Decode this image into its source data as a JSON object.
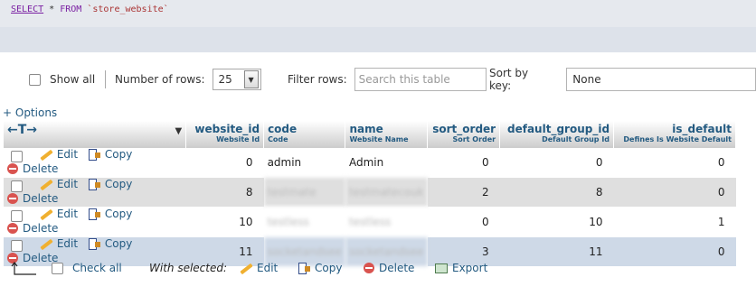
{
  "sql": {
    "select": "SELECT",
    "star": "*",
    "from": "FROM",
    "table": "`store_website`"
  },
  "controls": {
    "show_all_label": "Show all",
    "rows_label": "Number of rows:",
    "rows_value": "25",
    "filter_label": "Filter rows:",
    "filter_placeholder": "Search this table",
    "sort_label": "Sort by key:",
    "sort_value": "None"
  },
  "options_link": "+ Options",
  "table": {
    "nav_arrows": "←T→",
    "columns": [
      {
        "name": "website_id",
        "comment": "Website Id",
        "align": "num"
      },
      {
        "name": "code",
        "comment": "Code",
        "align": "txt"
      },
      {
        "name": "name",
        "comment": "Website Name",
        "align": "txt"
      },
      {
        "name": "sort_order",
        "comment": "Sort Order",
        "align": "num"
      },
      {
        "name": "default_group_id",
        "comment": "Default Group Id",
        "align": "num"
      },
      {
        "name": "is_default",
        "comment": "Defines Is Website Default",
        "align": "num"
      }
    ],
    "action_labels": {
      "edit": "Edit",
      "copy": "Copy",
      "delete": "Delete"
    },
    "rows": [
      {
        "website_id": "0",
        "code": "admin",
        "name": "Admin",
        "sort_order": "0",
        "default_group_id": "0",
        "is_default": "0",
        "style": "odd"
      },
      {
        "website_id": "8",
        "code": "testmate",
        "name": "testmatecouk",
        "sort_order": "2",
        "default_group_id": "8",
        "is_default": "0",
        "style": "even",
        "redacted": true
      },
      {
        "website_id": "10",
        "code": "testless",
        "name": "testless",
        "sort_order": "0",
        "default_group_id": "10",
        "is_default": "1",
        "style": "odd",
        "redacted": true
      },
      {
        "website_id": "11",
        "code": "socketandsee",
        "name": "socketandsee",
        "sort_order": "3",
        "default_group_id": "11",
        "is_default": "0",
        "style": "marked",
        "redacted": true
      }
    ]
  },
  "bottom": {
    "check_all": "Check all",
    "with_selected": "With selected:",
    "edit": "Edit",
    "copy": "Copy",
    "delete": "Delete",
    "export": "Export"
  },
  "icons": [
    "pencil-icon",
    "copy-icon",
    "delete-icon",
    "export-icon",
    "arrow-up-icon"
  ]
}
